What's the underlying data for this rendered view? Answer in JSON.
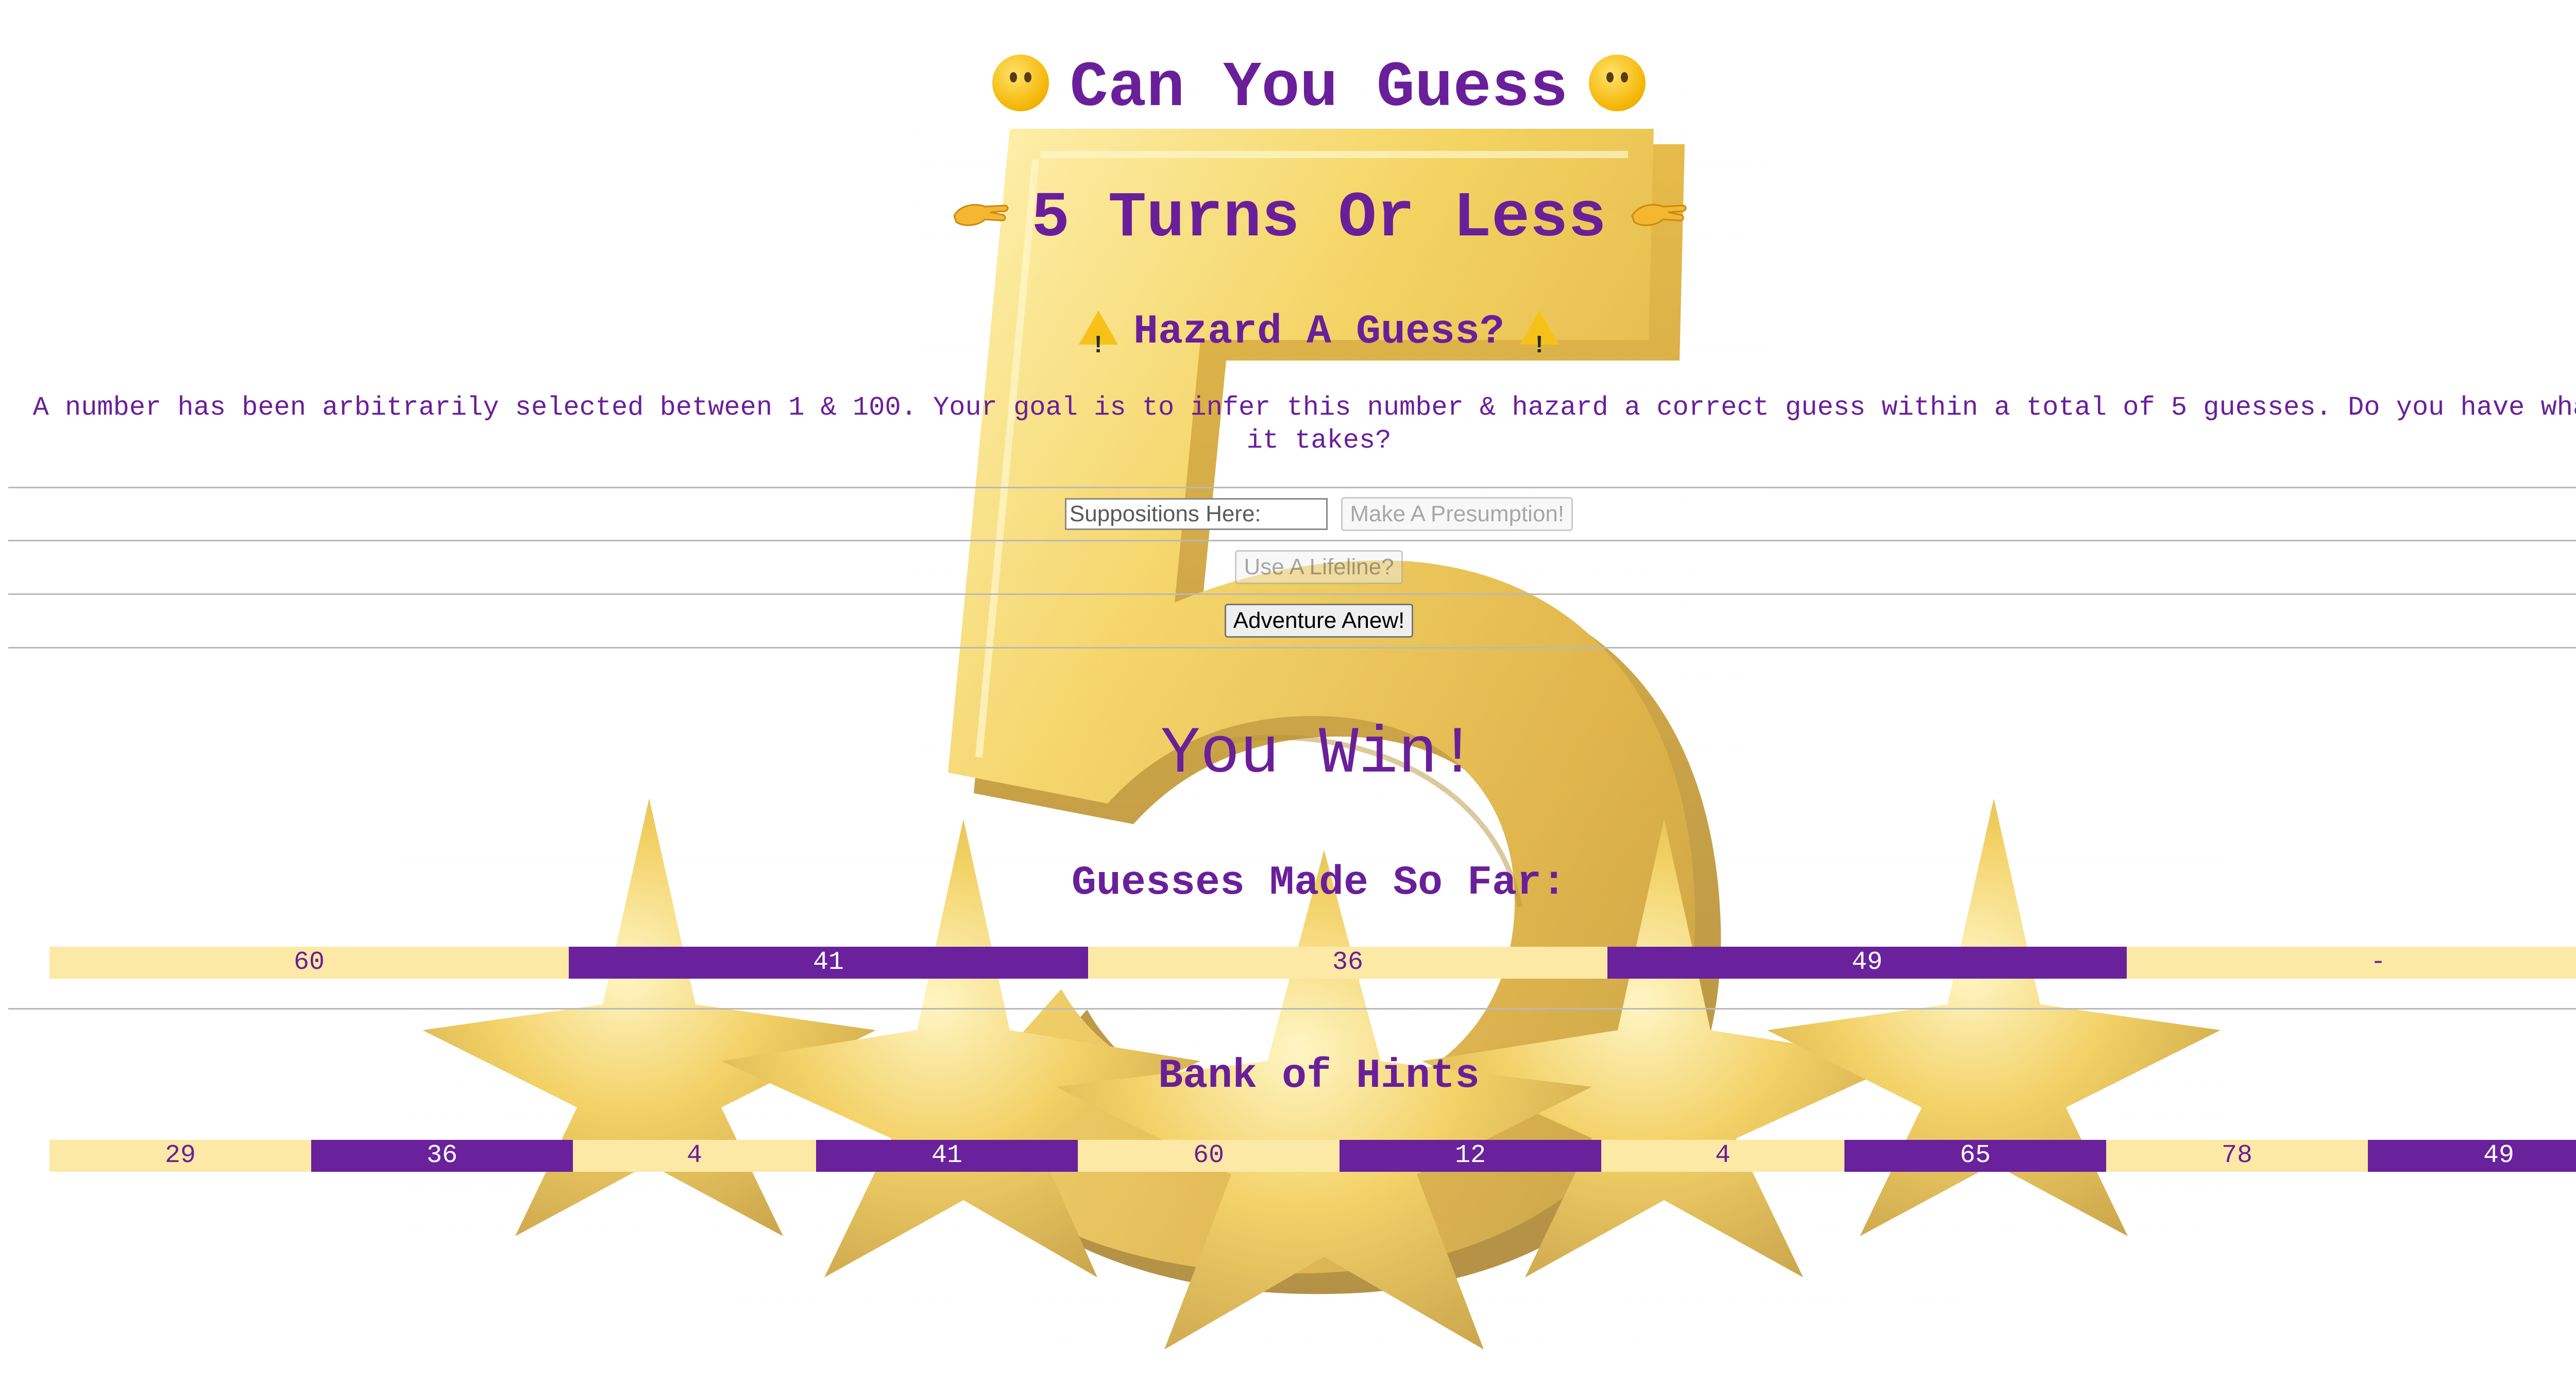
{
  "header": {
    "title_line_1": "Can You Guess",
    "title_line_2": "5 Turns Or Less",
    "subtitle": "Hazard A Guess?",
    "warn_glyph": "!",
    "title_1_icon": "thinking-face-icon",
    "title_2_icon": "pinching-hand-icon",
    "subtitle_icon": "warning-icon"
  },
  "intro": {
    "text": "A number has been arbitrarily selected between 1 & 100. Your goal is to infer this number & hazard a correct guess within a total of 5 guesses. Do you have what it takes?"
  },
  "controls": {
    "guess_placeholder": "Suppositions Here:",
    "guess_value": "",
    "submit_label": "Make A Presumption!",
    "submit_disabled": true,
    "lifeline_label": "Use A Lifeline?",
    "lifeline_disabled": true,
    "restart_label": "Adventure Anew!"
  },
  "result": {
    "message": "You Win!"
  },
  "guesses": {
    "heading": "Guesses Made So Far:",
    "items": [
      "60",
      "41",
      "36",
      "49",
      "-"
    ]
  },
  "hints": {
    "heading": "Bank of Hints",
    "items": [
      "29",
      "36",
      "4",
      "41",
      "60",
      "12",
      "4",
      "65",
      "78",
      "49"
    ]
  },
  "colors": {
    "text_purple": "#6a1f9a",
    "cell_light": "#fbe9a5",
    "cell_dark": "#69219c",
    "gold": "#e8b923"
  }
}
